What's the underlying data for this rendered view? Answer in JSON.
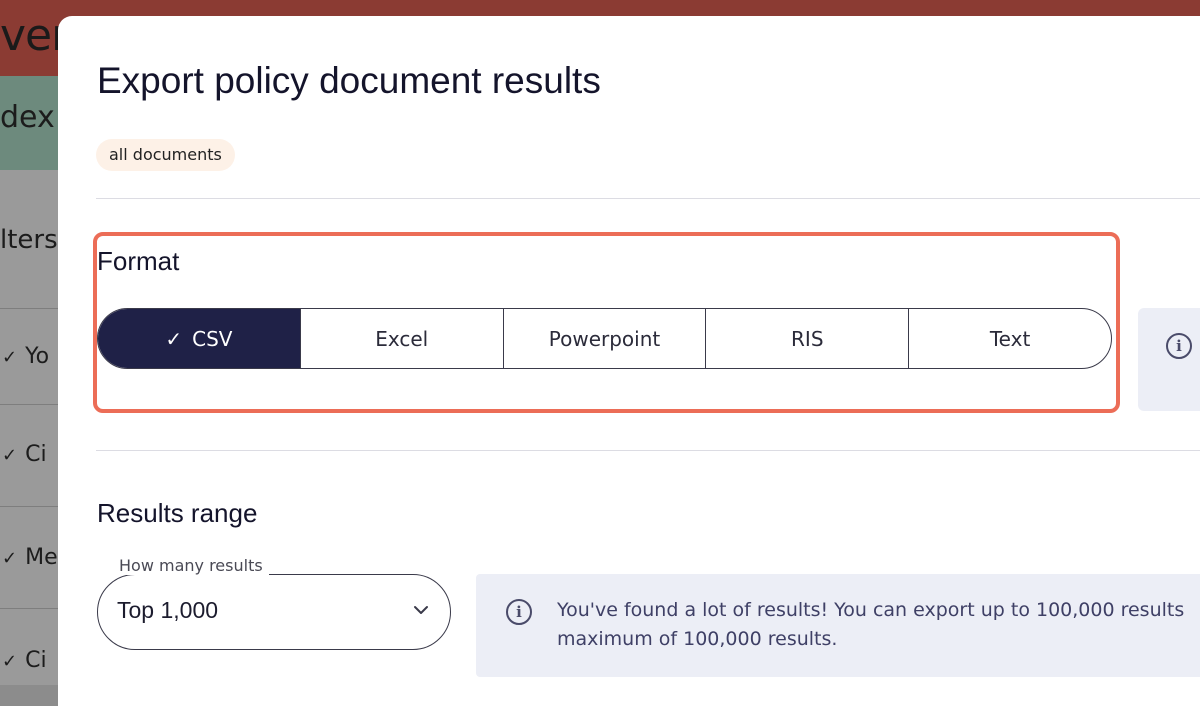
{
  "background": {
    "logo_text": "ver",
    "band_text": "dex",
    "filters_label": "lters",
    "rows": [
      "Yo",
      "Ci",
      "Me",
      "Ci"
    ]
  },
  "modal": {
    "title": "Export policy document results",
    "chip": "all documents",
    "format": {
      "heading": "Format",
      "options": [
        {
          "label": "CSV",
          "selected": true
        },
        {
          "label": "Excel",
          "selected": false
        },
        {
          "label": "Powerpoint",
          "selected": false
        },
        {
          "label": "RIS",
          "selected": false
        },
        {
          "label": "Text",
          "selected": false
        }
      ],
      "check_glyph": "✓",
      "highlight_color": "#ec6d57"
    },
    "results_range": {
      "heading": "Results range",
      "select_label": "How many results",
      "select_value": "Top 1,000",
      "info_line1": "You've found a lot of results! You can export up to 100,000 results",
      "info_line2": "maximum of 100,000 results."
    }
  },
  "icons": {
    "info": "info-icon",
    "check": "check-icon",
    "chevron": "chevron-down-icon"
  },
  "colors": {
    "selected_segment": "#1f2147",
    "info_background": "#eceef6",
    "chip_background": "#fdf1e7"
  }
}
